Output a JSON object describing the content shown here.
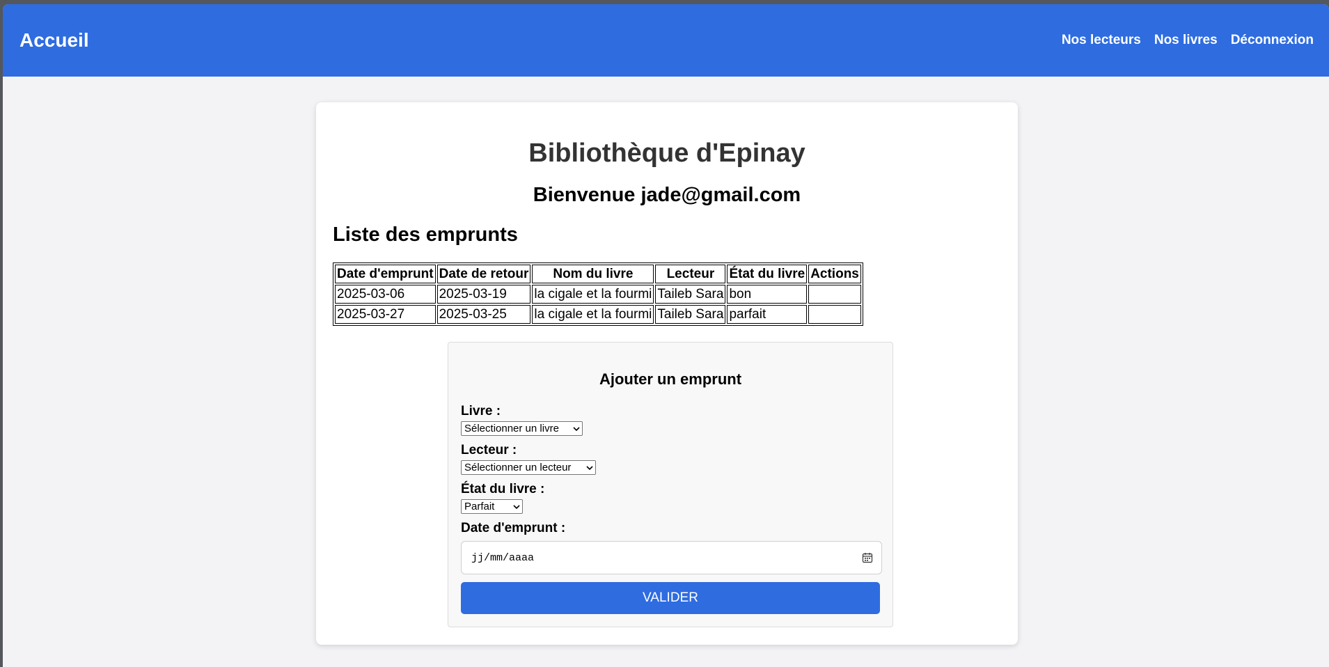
{
  "nav": {
    "brand": "Accueil",
    "links": [
      "Nos lecteurs",
      "Nos livres",
      "Déconnexion"
    ]
  },
  "page": {
    "title": "Bibliothèque d'Epinay",
    "welcome": "Bienvenue jade@gmail.com",
    "section_title": "Liste des emprunts"
  },
  "table": {
    "headers": [
      "Date d'emprunt",
      "Date de retour",
      "Nom du livre",
      "Lecteur",
      "État du livre",
      "Actions"
    ],
    "rows": [
      [
        "2025-03-06",
        "2025-03-19",
        "la cigale et la fourmi",
        "Taileb Sara",
        "bon",
        ""
      ],
      [
        "2025-03-27",
        "2025-03-25",
        "la cigale et la fourmi",
        "Taileb Sara",
        "parfait",
        ""
      ]
    ]
  },
  "form": {
    "title": "Ajouter un emprunt",
    "livre_label": "Livre :",
    "livre_value": "Sélectionner un livre",
    "lecteur_label": "Lecteur :",
    "lecteur_value": "Sélectionner un lecteur",
    "etat_label": "État du livre :",
    "etat_value": "Parfait",
    "date_label": "Date d'emprunt :",
    "date_placeholder": "jj/mm/aaaa",
    "submit_label": "VALIDER"
  },
  "icons": {
    "select_arrow": "chevron-down-icon",
    "date_picker": "calendar-icon"
  },
  "colors": {
    "primary": "#2e6ce0",
    "page_background": "#f3f3f6",
    "card_background": "#ffffff",
    "title_text": "#333333"
  }
}
